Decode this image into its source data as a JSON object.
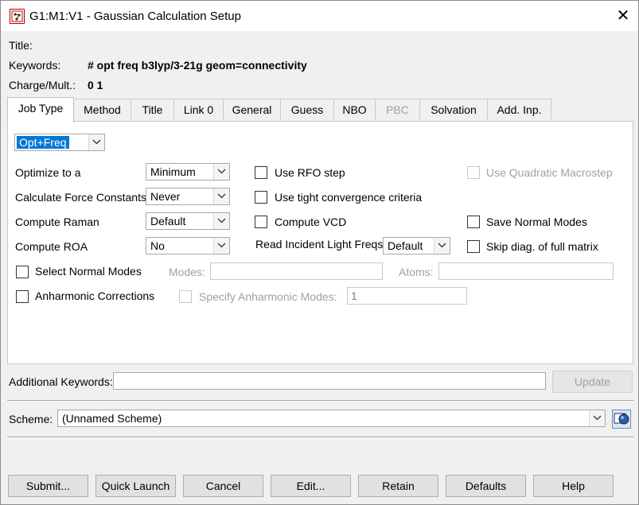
{
  "window": {
    "title": "G1:M1:V1 - Gaussian Calculation Setup",
    "close_glyph": "✕"
  },
  "header": {
    "title_label": "Title:",
    "keywords_label": "Keywords:",
    "keywords_value": "# opt freq b3lyp/3-21g geom=connectivity",
    "charge_label": "Charge/Mult.:",
    "charge_value": "0 1"
  },
  "tabs": [
    "Job Type",
    "Method",
    "Title",
    "Link 0",
    "General",
    "Guess",
    "NBO",
    "PBC",
    "Solvation",
    "Add. Inp."
  ],
  "active_tab": "Job Type",
  "job_type": {
    "job_combo": "Opt+Freq",
    "optimize_label": "Optimize to a",
    "optimize_value": "Minimum",
    "force_label": "Calculate Force Constants",
    "force_value": "Never",
    "raman_label": "Compute Raman",
    "raman_value": "Default",
    "roa_label": "Compute ROA",
    "roa_value": "No",
    "rfo_label": "Use RFO step",
    "tight_label": "Use tight convergence criteria",
    "vcd_label": "Compute VCD",
    "incident_label": "Read Incident Light Freqs",
    "incident_value": "Default",
    "quadratic_label": "Use Quadratic Macrostep",
    "save_modes_label": "Save Normal Modes",
    "skip_diag_label": "Skip diag. of full matrix",
    "select_modes_label": "Select Normal Modes",
    "modes_label": "Modes:",
    "atoms_label": "Atoms:",
    "anharmonic_label": "Anharmonic Corrections",
    "specify_anharmonic_label": "Specify Anharmonic Modes:",
    "anharmonic_value": "1"
  },
  "additional": {
    "label": "Additional Keywords:",
    "value": "",
    "update_label": "Update"
  },
  "scheme": {
    "label": "Scheme:",
    "value": "(Unnamed Scheme)"
  },
  "buttons": {
    "submit": "Submit...",
    "quick_launch": "Quick Launch",
    "cancel": "Cancel",
    "edit": "Edit...",
    "retain": "Retain",
    "defaults": "Defaults",
    "help": "Help"
  }
}
